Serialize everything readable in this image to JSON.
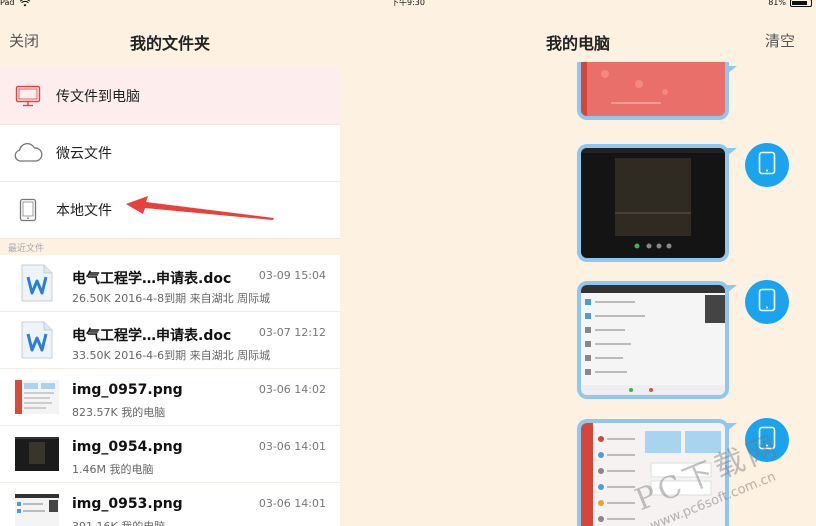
{
  "status_bar": {
    "device": "Pad",
    "time": "下午9:30",
    "battery_percent": "81%",
    "battery_level": 0.81
  },
  "left": {
    "close_label": "关闭",
    "title": "我的文件夹",
    "menu": [
      {
        "label": "传文件到电脑",
        "icon": "monitor-icon"
      },
      {
        "label": "微云文件",
        "icon": "cloud-icon"
      },
      {
        "label": "本地文件",
        "icon": "tablet-icon"
      }
    ],
    "recent_label": "最近文件",
    "files": [
      {
        "name": "电气工程学…申请表.doc",
        "meta": "26.50K 2016-4-8到期 来自湖北 周际城",
        "date": "03-09 15:04",
        "type": "doc"
      },
      {
        "name": "电气工程学…申请表.doc",
        "meta": "33.50K 2016-4-6到期 来自湖北 周际城",
        "date": "03-07 12:12",
        "type": "doc"
      },
      {
        "name": "img_0957.png",
        "meta": "823.57K  我的电脑",
        "date": "03-06 14:02",
        "type": "img-red"
      },
      {
        "name": "img_0954.png",
        "meta": "1.46M  我的电脑",
        "date": "03-06 14:01",
        "type": "img-dark"
      },
      {
        "name": "img_0953.png",
        "meta": "391.16K  我的电脑",
        "date": "03-06 14:01",
        "type": "img-blue"
      }
    ]
  },
  "right": {
    "title": "我的电脑",
    "clear_label": "清空"
  },
  "watermark": {
    "text": "PC下载网",
    "url": "www.pc6soft.com.cn"
  },
  "colors": {
    "background": "#fdf1e2",
    "accent": "#1aa3ee",
    "bubble": "#8ec8f0",
    "arrow": "#e8403a"
  }
}
